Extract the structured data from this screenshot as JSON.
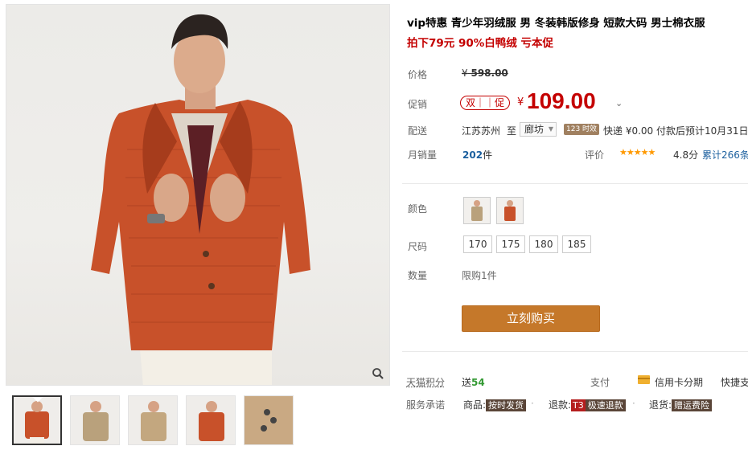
{
  "product": {
    "title": "vip特惠 青少年羽绒服 男 冬装韩版修身 短款大码 男士棉衣服",
    "subtitle": "拍下79元 90%白鸭绒 亏本促"
  },
  "price": {
    "label": "价格",
    "currency": "¥",
    "original": "598.00",
    "promo_label": "促销",
    "promo_tag": "双｜｜促",
    "promo_currency": "¥",
    "promo_price": "109.00",
    "accent_color": "#c40000"
  },
  "shipping": {
    "label": "配送",
    "from": "江苏苏州",
    "to_word": "至",
    "to_city": "廊坊",
    "speed_badge": "123 时效",
    "info": "快递 ¥0.00 付款后预计10月31日送"
  },
  "sales": {
    "label": "月销量",
    "count": "202",
    "unit": "件",
    "rating_label": "评价",
    "stars": "★★★★★",
    "score": "4.8分",
    "reviews": "累计266条"
  },
  "options": {
    "color_label": "颜色",
    "size_label": "尺码",
    "sizes": [
      "170",
      "175",
      "180",
      "185"
    ],
    "quantity_label": "数量",
    "quantity_limit": "限购1件"
  },
  "buy_button": "立刻购买",
  "footer": {
    "points_label": "天猫积分",
    "points_prefix": "送",
    "points_value": "54",
    "pay_label": "支付",
    "credit_card": "信用卡分期",
    "quick_pay": "快捷支",
    "promise_label": "服务承诺",
    "goods_label": "商品:",
    "goods_tag": "按时发货",
    "refund_label": "退款:",
    "refund_badge": "T3",
    "refund_tag": "极速退款",
    "return_label": "退货:",
    "return_tag": "赠运费险"
  },
  "icons": {
    "zoom": "magnifier-icon",
    "dropdown": "chevron-down-icon",
    "card": "credit-card-icon"
  }
}
